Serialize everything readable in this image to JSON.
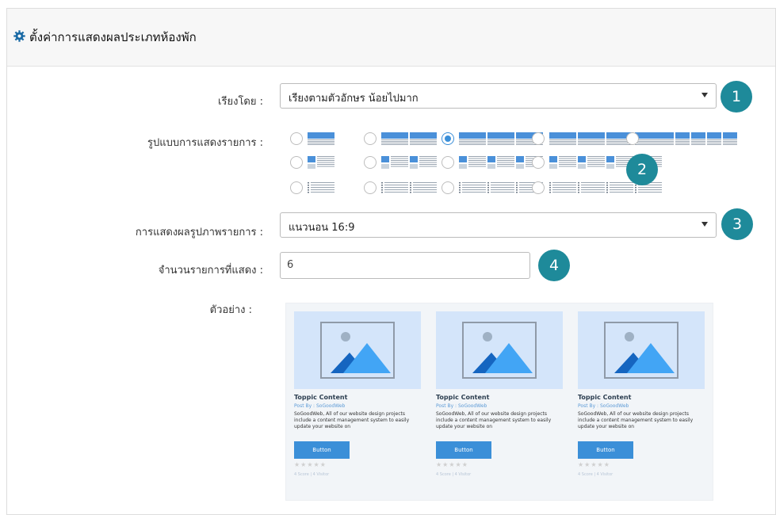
{
  "panel": {
    "title": "ตั้งค่าการแสดงผลประเภทห้องพัก",
    "icon": "gear-icon"
  },
  "form": {
    "sort": {
      "label": "เรียงโดย :",
      "value": "เรียงตามตัวอักษร น้อยไปมาก",
      "badge": "1"
    },
    "layout": {
      "label": "รูปแบบการแสดงรายการ :",
      "badge": "2",
      "selected_option": "grid-3-columns"
    },
    "image": {
      "label": "การแสดงผลรูปภาพรายการ :",
      "value": "แนวนอน 16:9",
      "badge": "3"
    },
    "count": {
      "label": "จำนวนรายการที่แสดง :",
      "value": "6",
      "badge": "4"
    },
    "preview": {
      "label": "ตัวอย่าง :"
    }
  },
  "preview_cards": [
    {
      "title": "Toppic Content",
      "by": "Post By : SoGoodWeb",
      "desc": "SoGoodWeb, All of our website design projects include a content management system to easily update your website on",
      "button": "Button",
      "stars": "★★★★★",
      "meta": "4 Score | 4 Visitor"
    },
    {
      "title": "Toppic Content",
      "by": "Post By : SoGoodWeb",
      "desc": "SoGoodWeb, All of our website design projects include a content management system to easily update your website on",
      "button": "Button",
      "stars": "★★★★★",
      "meta": "4 Score | 4 Visitor"
    },
    {
      "title": "Toppic Content",
      "by": "Post By : SoGoodWeb",
      "desc": "SoGoodWeb, All of our website design projects include a content management system to easily update your website on",
      "button": "Button",
      "stars": "★★★★★",
      "meta": "4 Score | 4 Visitor"
    }
  ],
  "colors": {
    "accent": "#3b8fd8",
    "badge": "#1e8a9a",
    "thumb": "#d4e5fa",
    "icon_dark": "#1565c0",
    "icon_light": "#42a5f5"
  }
}
